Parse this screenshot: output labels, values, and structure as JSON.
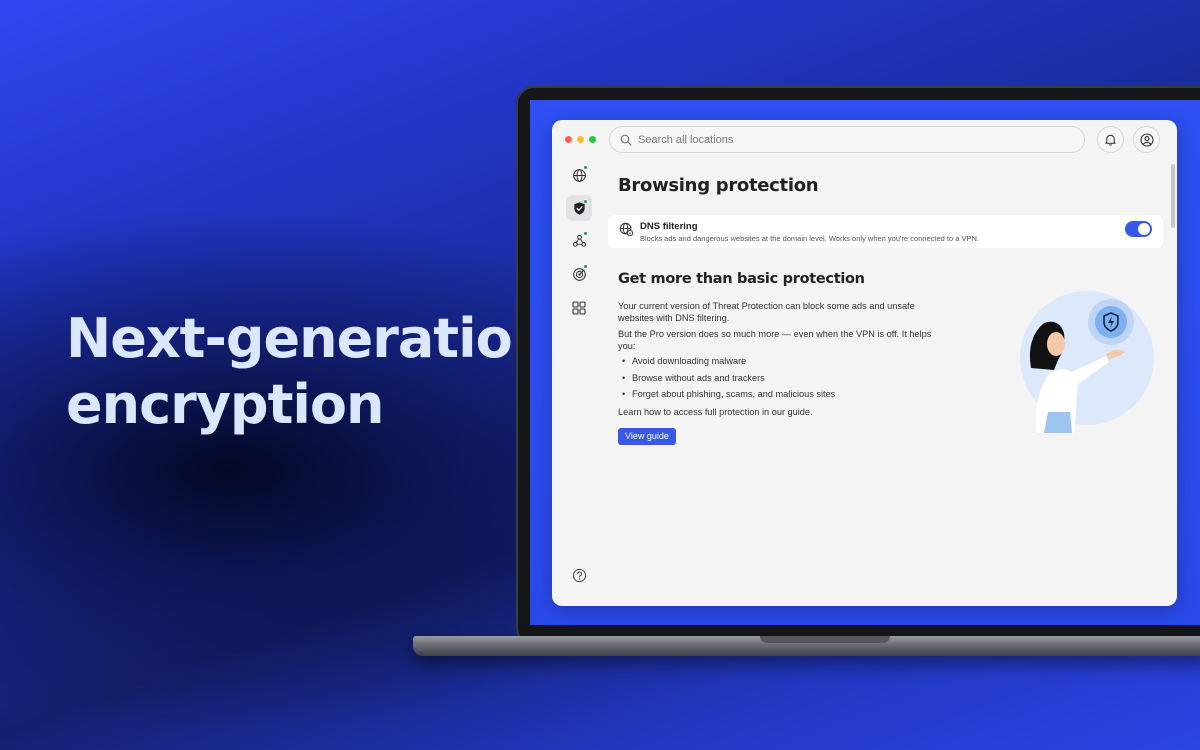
{
  "marketing": {
    "headline_line1": "Next-generation",
    "headline_line2": "encryption"
  },
  "window": {
    "search": {
      "placeholder": "Search all locations"
    },
    "header_icons": [
      "bell-icon",
      "user-icon"
    ],
    "sidebar": {
      "items": [
        {
          "icon": "globe-icon",
          "status_dot": true,
          "active": false
        },
        {
          "icon": "shield-icon",
          "status_dot": true,
          "active": true
        },
        {
          "icon": "meshnet-icon",
          "status_dot": true,
          "active": false
        },
        {
          "icon": "eye-radar-icon",
          "status_dot": true,
          "active": false
        },
        {
          "icon": "grid-icon",
          "status_dot": false,
          "active": false
        }
      ],
      "help_icon": "question-icon"
    },
    "page_title": "Browsing protection",
    "dns": {
      "title": "DNS filtering",
      "description": "Blocks ads and dangerous websites at the domain level. Works only when you're connected to a VPN.",
      "enabled": true
    },
    "promo": {
      "title": "Get more than basic protection",
      "paragraph1": "Your current version of Threat Protection can block some ads and unsafe websites with DNS filtering.",
      "paragraph2": "But the Pro version does so much more — even when the VPN is off. It helps you:",
      "bullets": [
        "Avoid downloading malware",
        "Browse without ads and trackers",
        "Forget about phishing, scams, and malicious sites"
      ],
      "paragraph3": "Learn how to access full protection in our guide.",
      "button_label": "View guide"
    }
  },
  "colors": {
    "accent": "#3858e9",
    "status_dot": "#1f9d55",
    "background_blue": "#2236c8"
  }
}
